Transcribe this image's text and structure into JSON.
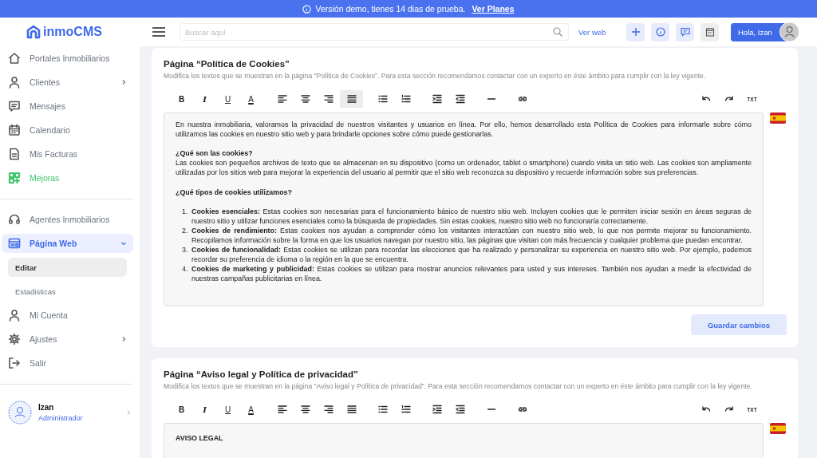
{
  "banner": {
    "text": "Versión demo, tienes 14 dias de prueba.",
    "link": "Ver Planes"
  },
  "sidebar": {
    "logo": "inmoCMS",
    "groups": [
      {
        "items": [
          {
            "label": "Portales Inmobiliarios",
            "selected": false
          },
          {
            "label": "Clientes",
            "selected": false,
            "expanded": false
          },
          {
            "label": "Mensajes",
            "selected": false
          },
          {
            "label": "Calendario",
            "selected": false
          },
          {
            "label": "Mis Facturas",
            "selected": false
          },
          {
            "label": "Mejoras",
            "selected": false,
            "color": "#3ec46d"
          }
        ]
      },
      {
        "items": [
          {
            "label": "Agentes Inmobiliarios",
            "selected": false
          },
          {
            "label": "Página Web",
            "selected": true,
            "expanded": true,
            "children": [
              {
                "label": "Editar",
                "selected": true
              },
              {
                "label": "Estadisticas",
                "selected": false
              }
            ]
          },
          {
            "label": "Mi Cuenta",
            "selected": false
          },
          {
            "label": "Ajustes",
            "selected": false,
            "expanded": false
          },
          {
            "label": "Salir",
            "selected": false
          }
        ]
      }
    ],
    "user": {
      "name": "Izan",
      "role": "Administrador"
    }
  },
  "topbar": {
    "search": {
      "placeholder": "Buscar aquí"
    },
    "link": "Ver web",
    "greeting": "Hola, Izan"
  },
  "cards": [
    {
      "title": "Página “Política de Cookies”",
      "description": "Modifica los textos que se muestran en la página “Política de Cookies”. Para esta sección recomendamos contactar con un experto en éste ámbito para cumplir con la ley vigente.",
      "toolbar": [
        {
          "kind": "text",
          "label": "B",
          "selected": false
        },
        {
          "kind": "text",
          "label": "I",
          "selected": false
        },
        {
          "kind": "text",
          "label": "U",
          "selected": false
        },
        {
          "kind": "text",
          "label": "A",
          "selected": false
        },
        {
          "kind": "icon",
          "selected": false
        },
        {
          "kind": "icon",
          "selected": false
        },
        {
          "kind": "icon",
          "selected": false
        },
        {
          "kind": "icon",
          "selected": true
        },
        {
          "kind": "icon",
          "selected": false
        },
        {
          "kind": "icon",
          "selected": false
        },
        {
          "kind": "icon",
          "selected": false
        },
        {
          "kind": "icon",
          "selected": false
        },
        {
          "kind": "icon",
          "selected": false
        },
        {
          "kind": "icon",
          "selected": false
        },
        {
          "kind": "icon",
          "selected": false
        },
        {
          "kind": "icon",
          "selected": false
        },
        {
          "kind": "text",
          "label": "TXT",
          "selected": false
        }
      ],
      "blocks": [
        {
          "kind": "paragraph",
          "text": "En nuestra inmobiliaria, valoramos la privacidad de nuestros visitantes y usuarios en línea. Por ello, hemos desarrollado esta Política de Cookies para informarle sobre cómo utilizamos las cookies en nuestro sitio web y para brindarle opciones sobre cómo puede gestionarlas."
        },
        {
          "kind": "heading",
          "text": "¿Qué son las cookies?"
        },
        {
          "kind": "paragraph",
          "text": "Las cookies son pequeños archivos de texto que se almacenan en su dispositivo (como un ordenador, tablet o smartphone) cuando visita un sitio web. Las cookies son ampliamente utilizadas por los sitios web para mejorar la experiencia del usuario al permitir que el sitio web reconozca su dispositivo y recuerde información sobre sus preferencias."
        },
        {
          "kind": "heading",
          "text": "¿Qué tipos de cookies utilizamos?"
        },
        {
          "kind": "list",
          "items": [
            {
              "marker": "1.",
              "text": "**Cookies esenciales:** Estas cookies son necesarias para el funcionamiento básico de nuestro sitio web. Incluyen cookies que le permiten iniciar sesión en áreas seguras de nuestro sitio y utilizar funciones esenciales como la búsqueda de propiedades. Sin estas cookies, nuestro sitio web no funcionaría correctamente."
            },
            {
              "marker": "2.",
              "text": "**Cookies de rendimiento:** Estas cookies nos ayudan a comprender cómo los visitantes interactúan con nuestro sitio web, lo que nos permite mejorar su funcionamiento. Recopilamos información sobre la forma en que los usuarios navegan por nuestro sitio, las páginas que visitan con más frecuencia y cualquier problema que puedan encontrar."
            },
            {
              "marker": "3.",
              "text": "**Cookies de funcionalidad:** Estas cookies se utilizan para recordar las elecciones que ha realizado y personalizar su experiencia en nuestro sitio web. Por ejemplo, podemos recordar su preferencia de idioma o la región en la que se encuentra."
            },
            {
              "marker": "4.",
              "text": "**Cookies de marketing y publicidad:** Estas cookies se utilizan para mostrar anuncios relevantes para usted y sus intereses. También nos ayudan a medir la efectividad de nuestras campañas publicitarias en línea."
            }
          ]
        }
      ],
      "save": "Guardar cambios"
    },
    {
      "title": "Página “Aviso legal y Política de privacidad”",
      "description": "Modifica los textos que se muestran en la página “Aviso legal y Política de privacidad”. Para esta sección recomendamos contactar con un experto en éste ámbito para cumplir con la ley vigente.",
      "toolbar": [
        {
          "kind": "text",
          "label": "B",
          "selected": false
        },
        {
          "kind": "text",
          "label": "I",
          "selected": false
        },
        {
          "kind": "text",
          "label": "U",
          "selected": false
        },
        {
          "kind": "text",
          "label": "A",
          "selected": false
        },
        {
          "kind": "icon",
          "selected": false
        },
        {
          "kind": "icon",
          "selected": false
        },
        {
          "kind": "icon",
          "selected": false
        },
        {
          "kind": "icon",
          "selected": false
        },
        {
          "kind": "icon",
          "selected": false
        },
        {
          "kind": "icon",
          "selected": false
        },
        {
          "kind": "icon",
          "selected": false
        },
        {
          "kind": "icon",
          "selected": false
        },
        {
          "kind": "icon",
          "selected": false
        },
        {
          "kind": "icon",
          "selected": false
        },
        {
          "kind": "icon",
          "selected": false
        },
        {
          "kind": "icon",
          "selected": false
        },
        {
          "kind": "text",
          "label": "TXT",
          "selected": false
        }
      ],
      "blocks": [
        {
          "kind": "heading",
          "text": "AVISO LEGAL"
        }
      ]
    }
  ]
}
